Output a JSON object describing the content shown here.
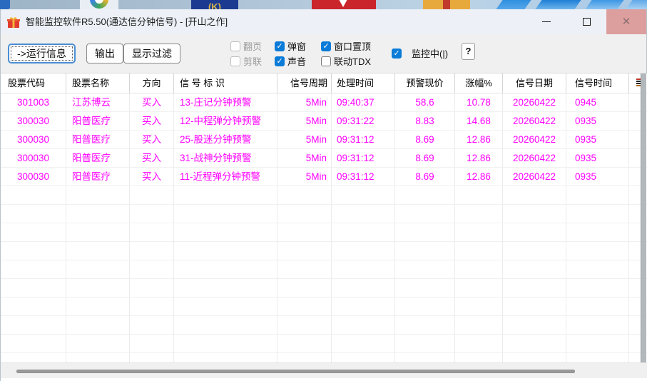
{
  "titlebar": {
    "title": "智能监控软件R5.50(通达信分钟信号) - [开山之作]"
  },
  "toolbar": {
    "buttons": [
      {
        "label": "->运行信息",
        "focused": true
      },
      {
        "label": "输出",
        "focused": false
      },
      {
        "label": "显示过滤",
        "focused": false
      }
    ],
    "checkbox_groups": [
      [
        {
          "label": "翻页",
          "checked": false,
          "disabled": true
        },
        {
          "label": "剪联",
          "checked": false,
          "disabled": true
        }
      ],
      [
        {
          "label": "弹窗",
          "checked": true,
          "disabled": false
        },
        {
          "label": "声音",
          "checked": true,
          "disabled": false
        }
      ],
      [
        {
          "label": "窗口置顶",
          "checked": true,
          "disabled": false
        },
        {
          "label": "联动TDX",
          "checked": false,
          "disabled": false
        }
      ]
    ],
    "monitor": {
      "label": "监控中(|)",
      "checked": true
    },
    "help_label": "?"
  },
  "table": {
    "headers": [
      "股票代码",
      "股票名称",
      "方向",
      "信 号 标 识",
      "信号周期",
      "处理时间",
      "预警现价",
      "涨幅%",
      "信号日期",
      "信号时间"
    ],
    "rows": [
      [
        "301003",
        "江苏博云",
        "买入",
        "13-庄记分钟预警",
        "5Min",
        "09:40:37",
        "58.6",
        "10.78",
        "20260422",
        "0945"
      ],
      [
        "300030",
        "阳普医疗",
        "买入",
        "12-中程弹分钟预警",
        "5Min",
        "09:31:22",
        "8.83",
        "14.68",
        "20260422",
        "0935"
      ],
      [
        "300030",
        "阳普医疗",
        "买入",
        "25-股迷分钟预警",
        "5Min",
        "09:31:12",
        "8.69",
        "12.86",
        "20260422",
        "0935"
      ],
      [
        "300030",
        "阳普医疗",
        "买入",
        "31-战神分钟预警",
        "5Min",
        "09:31:12",
        "8.69",
        "12.86",
        "20260422",
        "0935"
      ],
      [
        "300030",
        "阳普医疗",
        "买入",
        "11-近程弹分钟预警",
        "5Min",
        "09:31:12",
        "8.69",
        "12.86",
        "20260422",
        "0935"
      ]
    ]
  },
  "colors": {
    "accent_checkbox": "#0b7bd8",
    "row_text": "#ff00ff",
    "close_button_bg": "#dd9e9e",
    "titlebar_bg": "#edf1f7",
    "toolbar_bg": "#f0f0f0"
  }
}
